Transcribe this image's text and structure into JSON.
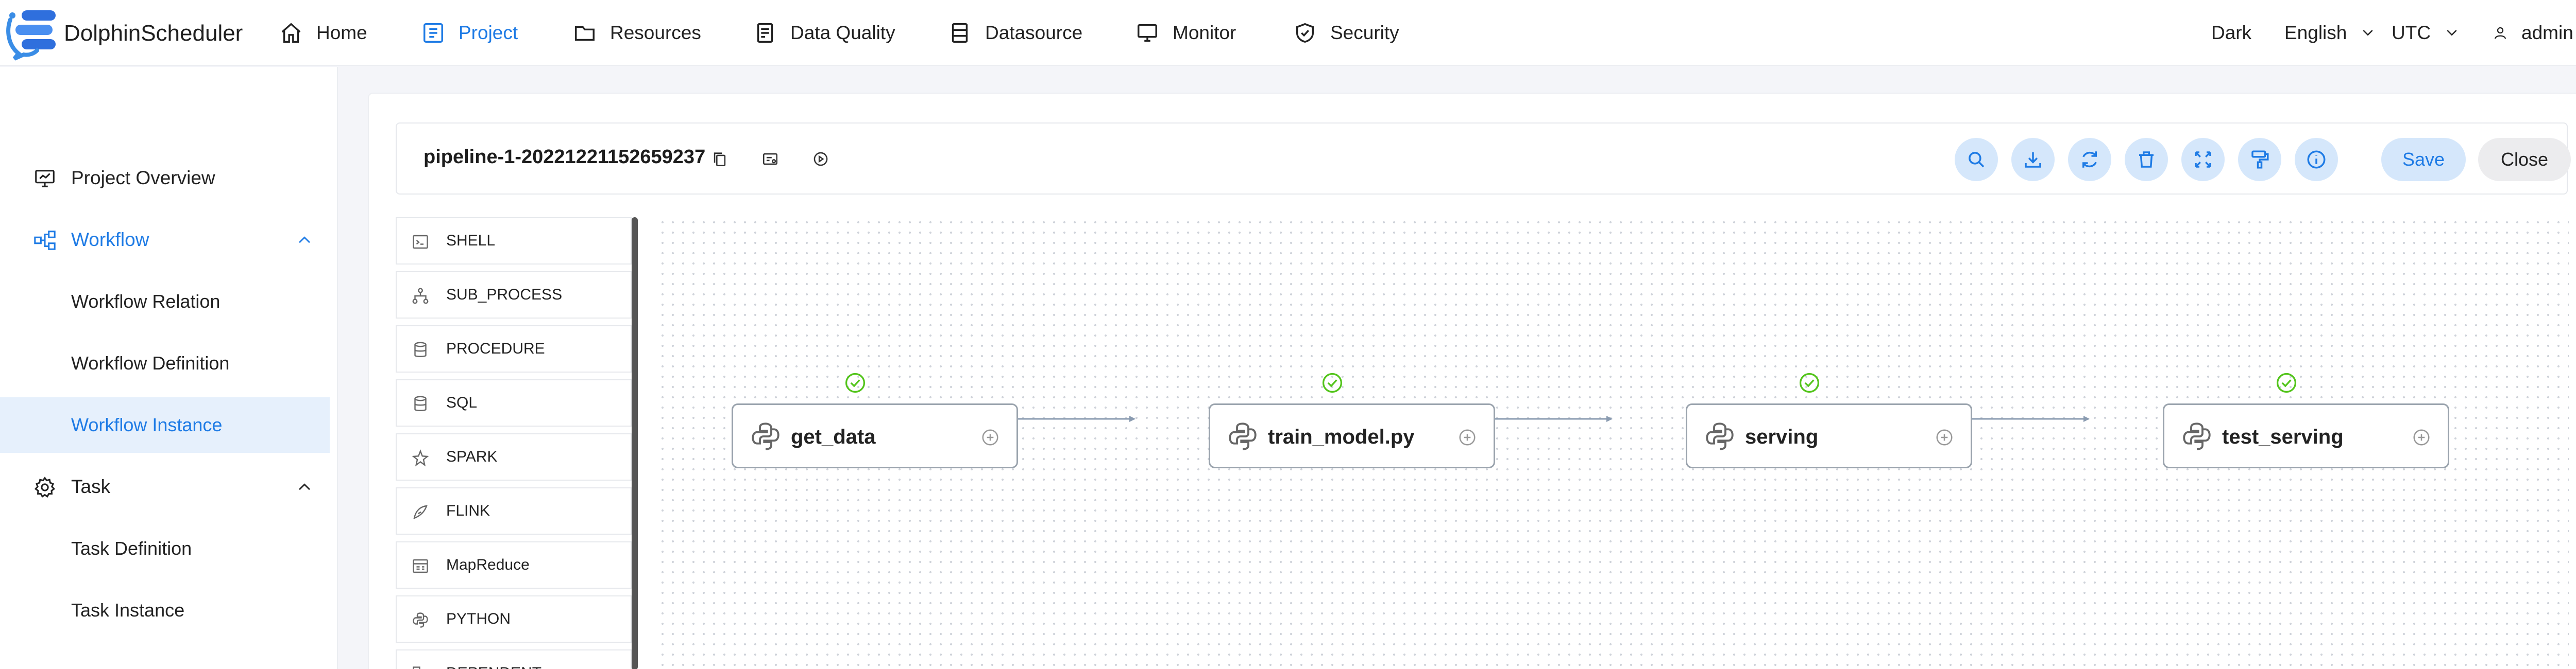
{
  "app": {
    "brand": "DolphinScheduler"
  },
  "nav": {
    "items": [
      {
        "label": "Home",
        "icon": "home-icon"
      },
      {
        "label": "Project",
        "icon": "project-icon",
        "active": true
      },
      {
        "label": "Resources",
        "icon": "folder-icon"
      },
      {
        "label": "Data Quality",
        "icon": "data-quality-icon"
      },
      {
        "label": "Datasource",
        "icon": "database-icon"
      },
      {
        "label": "Monitor",
        "icon": "monitor-icon"
      },
      {
        "label": "Security",
        "icon": "shield-icon"
      }
    ],
    "theme": "Dark",
    "language": "English",
    "timezone": "UTC",
    "user": "admin"
  },
  "sidebar": {
    "overview": "Project Overview",
    "workflow": "Workflow",
    "workflow_items": [
      "Workflow Relation",
      "Workflow Definition",
      "Workflow Instance"
    ],
    "selected": "Workflow Instance",
    "task": "Task",
    "task_items": [
      "Task Definition",
      "Task Instance"
    ]
  },
  "toolbar": {
    "workflow_name": "pipeline-1-20221221152659237",
    "save_label": "Save",
    "close_label": "Close"
  },
  "palette": {
    "items": [
      {
        "label": "SHELL",
        "icon": "shell-icon"
      },
      {
        "label": "SUB_PROCESS",
        "icon": "sub-process-icon"
      },
      {
        "label": "PROCEDURE",
        "icon": "procedure-icon"
      },
      {
        "label": "SQL",
        "icon": "sql-icon"
      },
      {
        "label": "SPARK",
        "icon": "spark-icon"
      },
      {
        "label": "FLINK",
        "icon": "flink-icon"
      },
      {
        "label": "MapReduce",
        "icon": "mapreduce-icon"
      },
      {
        "label": "PYTHON",
        "icon": "python-icon"
      },
      {
        "label": "DEPENDENT",
        "icon": "dependent-icon"
      }
    ]
  },
  "dag": {
    "nodes": [
      {
        "label": "get_data",
        "status": "success"
      },
      {
        "label": "train_model.py",
        "status": "success"
      },
      {
        "label": "serving",
        "status": "success"
      },
      {
        "label": "test_serving",
        "status": "success"
      }
    ]
  },
  "colors": {
    "accent": "#1e7be5",
    "success": "#52c41a",
    "edge": "#8a9bb0"
  }
}
